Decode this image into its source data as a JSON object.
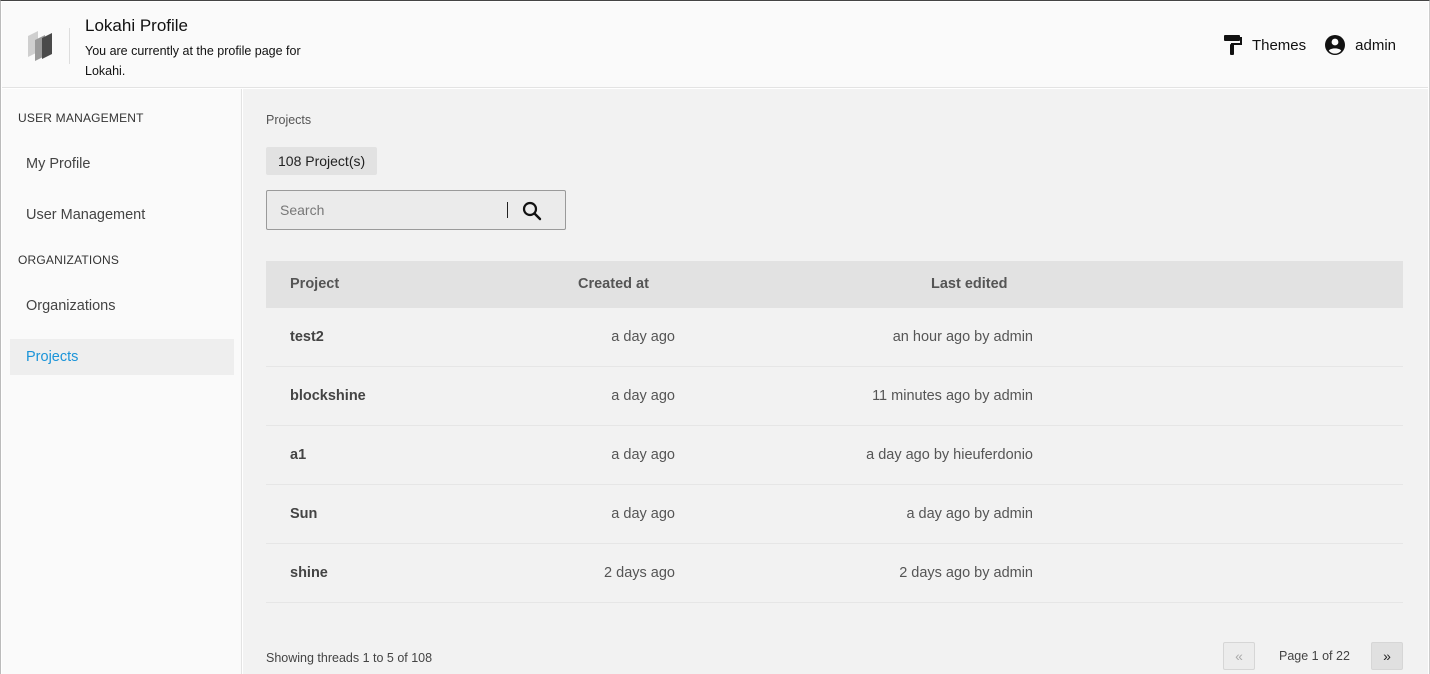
{
  "header": {
    "title": "Lokahi Profile",
    "subtitle": "You are currently at the profile page for Lokahi.",
    "themes_label": "Themes",
    "user_label": "admin"
  },
  "sidebar": {
    "sections": [
      {
        "label": "USER MANAGEMENT",
        "items": [
          {
            "label": "My Profile",
            "active": false
          },
          {
            "label": "User Management",
            "active": false
          }
        ]
      },
      {
        "label": "ORGANIZATIONS",
        "items": [
          {
            "label": "Organizations",
            "active": false
          },
          {
            "label": "Projects",
            "active": true
          }
        ]
      }
    ],
    "accent_color": "#1a94d9"
  },
  "main": {
    "breadcrumb": "Projects",
    "count_badge": "108 Project(s)",
    "search": {
      "placeholder": "Search",
      "value": ""
    },
    "table": {
      "columns": [
        "Project",
        "Created at",
        "Last edited"
      ],
      "rows": [
        {
          "project": "test2",
          "created": "a day ago",
          "edited": "an hour ago by admin"
        },
        {
          "project": "blockshine",
          "created": "a day ago",
          "edited": "11 minutes ago by admin"
        },
        {
          "project": "a1",
          "created": "a day ago",
          "edited": "a day ago by hieuferdonio"
        },
        {
          "project": "Sun",
          "created": "a day ago",
          "edited": "a day ago by admin"
        },
        {
          "project": "shine",
          "created": "2 days ago",
          "edited": "2 days ago by admin"
        }
      ]
    },
    "footer": {
      "showing": "Showing threads 1 to 5 of 108",
      "page_label": "Page 1 of 22",
      "prev_label": "«",
      "next_label": "»"
    }
  }
}
